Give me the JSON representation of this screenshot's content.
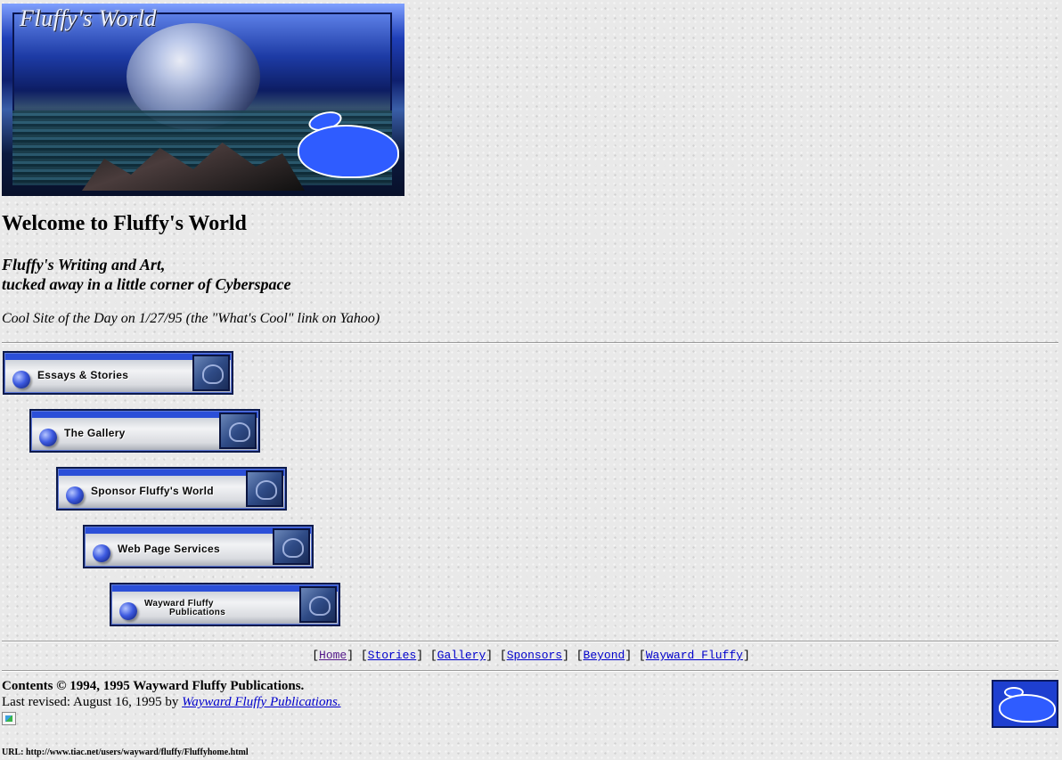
{
  "banner": {
    "logo_text": "Fluffy's World"
  },
  "heading": {
    "welcome": "Welcome to Fluffy's World"
  },
  "tagline": {
    "line1": "Fluffy's Writing and Art,",
    "line2": "tucked away in a little corner of Cyberspace"
  },
  "cool_site": "Cool Site of the Day on 1/27/95 (the \"What's Cool\" link on Yahoo)",
  "nav_buttons": [
    {
      "label": "Essays & Stories"
    },
    {
      "label": "The Gallery"
    },
    {
      "label": "Sponsor Fluffy's World"
    },
    {
      "label": "Web Page Services"
    },
    {
      "label_line1": "Wayward Fluffy",
      "label_line2": "Publications"
    }
  ],
  "text_nav": {
    "open_bracket": "[",
    "close_bracket": "]",
    "separator": "] [",
    "links": [
      "Home",
      "Stories",
      "Gallery",
      "Sponsors",
      "Beyond",
      "Wayward Fluffy"
    ]
  },
  "footer": {
    "copyright": "Contents © 1994, 1995 Wayward Fluffy Publications.",
    "revised_prefix": "Last revised: August 16, 1995 by",
    "revised_link": "Wayward Fluffy Publications.",
    "url": "URL: http://www.tiac.net/users/wayward/fluffy/Fluffyhome.html"
  },
  "colors": {
    "link": "#0000cc",
    "visited_link": "#551a8b",
    "bunny_blue": "#2f5cff",
    "banner_blue": "#1f3fb8"
  },
  "icons": {
    "banner_bunny": "rabbit-icon",
    "corner_logo": "rabbit-icon",
    "button_ball": "sphere-icon"
  }
}
